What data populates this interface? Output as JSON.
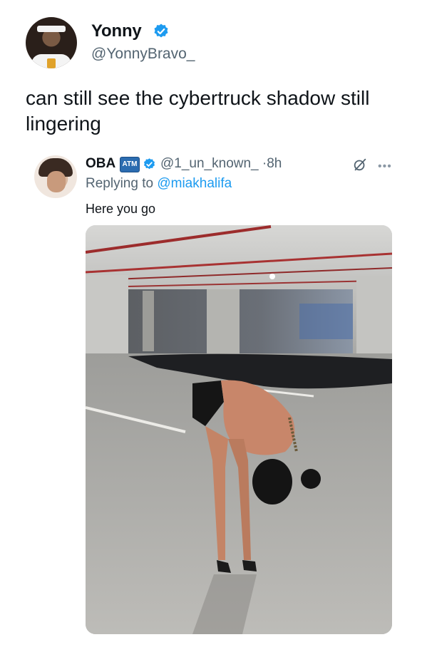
{
  "tweet": {
    "author_name": "Yonny",
    "author_handle": "@YonnyBravo_",
    "text": "can still see the cybertruck shadow still lingering"
  },
  "reply": {
    "author_name": "OBA",
    "badge_label": "ATM",
    "author_handle": "@1_un_known_",
    "separator": "·",
    "time": "8h",
    "replying_prefix": "Replying to ",
    "replying_to": "@miakhalifa",
    "text": "Here you go"
  },
  "icons": {
    "verified": "verified-badge-icon",
    "grok": "grok-icon",
    "more": "more-options-icon"
  },
  "colors": {
    "accent": "#1d9bf0",
    "muted": "#536471",
    "text": "#0f1419"
  }
}
